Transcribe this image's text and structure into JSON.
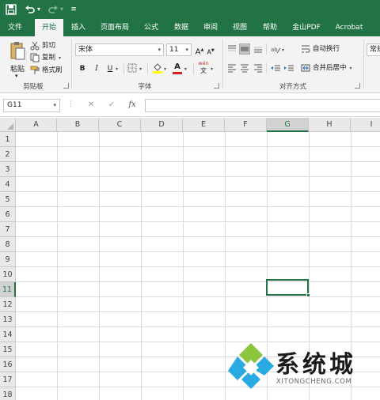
{
  "quick_access": {
    "save_icon": "save-icon",
    "undo_icon": "undo-icon",
    "redo_icon": "redo-icon",
    "customize_icon": "customize-icon",
    "undo_caret": "▾",
    "redo_caret": "▾",
    "customize_glyph": "≡"
  },
  "tabs": [
    {
      "label": "文件"
    },
    {
      "label": "开始"
    },
    {
      "label": "插入"
    },
    {
      "label": "页面布局"
    },
    {
      "label": "公式"
    },
    {
      "label": "数据"
    },
    {
      "label": "审阅"
    },
    {
      "label": "视图"
    },
    {
      "label": "帮助"
    },
    {
      "label": "金山PDF"
    },
    {
      "label": "Acrobat"
    }
  ],
  "ribbon": {
    "clipboard": {
      "group_label": "剪贴板",
      "paste_label": "粘贴",
      "cut_label": "剪切",
      "copy_label": "复制",
      "format_painter_label": "格式刷"
    },
    "font": {
      "group_label": "字体",
      "font_name": "宋体",
      "font_size": "11",
      "grow_label": "A",
      "shrink_label": "A",
      "bold_label": "B",
      "italic_label": "I",
      "underline_label": "U",
      "font_color_label": "A",
      "phonetic_label": "wén"
    },
    "alignment": {
      "group_label": "对齐方式",
      "wrap_text_label": "自动换行",
      "merge_center_label": "合并后居中"
    },
    "number": {
      "format_value": "常规"
    }
  },
  "formula_bar": {
    "name_box_value": "G11",
    "cancel_symbol": "✕",
    "enter_symbol": "✓",
    "fx_symbol": "fx",
    "formula_value": ""
  },
  "grid": {
    "columns": [
      "A",
      "B",
      "C",
      "D",
      "E",
      "F",
      "G",
      "H",
      "I"
    ],
    "rows": [
      "1",
      "2",
      "3",
      "4",
      "5",
      "6",
      "7",
      "8",
      "9",
      "10",
      "11",
      "12",
      "13",
      "14",
      "15",
      "16",
      "17",
      "18"
    ],
    "selected_column": "G",
    "selected_row": "11"
  },
  "watermark": {
    "title": "系统城",
    "subtitle": "XITONGCHENG.COM"
  },
  "colors": {
    "brand_green": "#217346",
    "ribbon_bg": "#f3f3f3",
    "grid_line": "#dadada"
  }
}
